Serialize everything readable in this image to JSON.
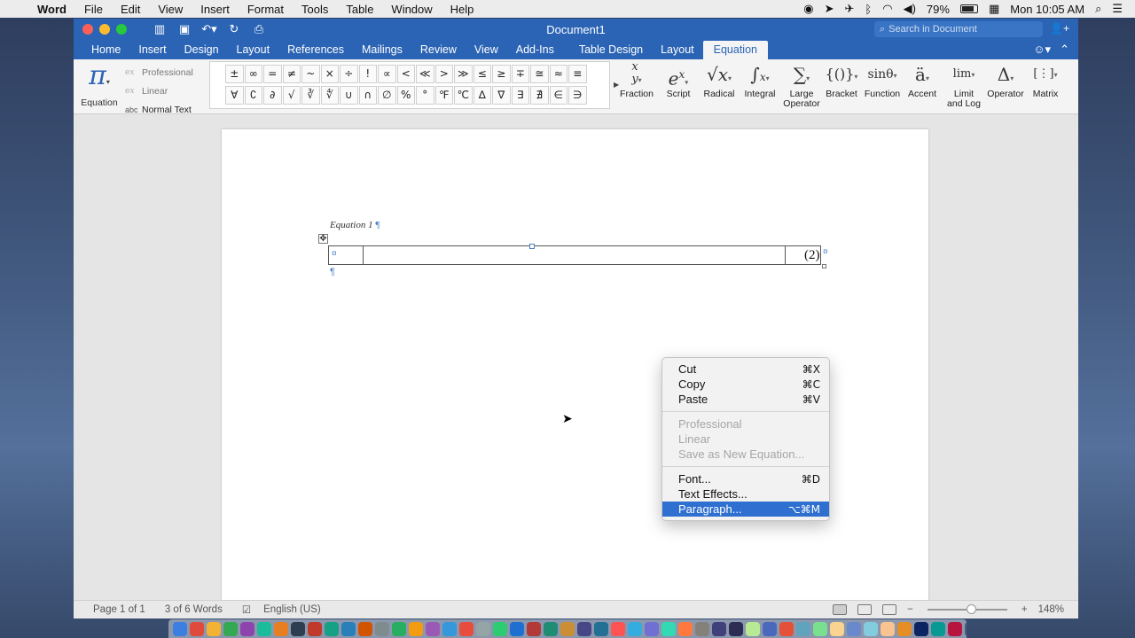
{
  "menubar": {
    "app_name": "Word",
    "items": [
      "File",
      "Edit",
      "View",
      "Insert",
      "Format",
      "Tools",
      "Table",
      "Window",
      "Help"
    ],
    "battery": "79%",
    "clock": "Mon 10:05 AM"
  },
  "window": {
    "title": "Document1",
    "search_placeholder": "Search in Document"
  },
  "tabs": [
    "Home",
    "Insert",
    "Design",
    "Layout",
    "References",
    "Mailings",
    "Review",
    "View",
    "Add-Ins"
  ],
  "context_tabs": [
    "Table Design",
    "Layout"
  ],
  "active_tab": "Equation",
  "ribbon": {
    "equation_label": "Equation",
    "formats": [
      "Professional",
      "Linear",
      "Normal Text"
    ],
    "formats_prefix": "abc",
    "symbols_row1": [
      "±",
      "∞",
      "=",
      "≠",
      "~",
      "×",
      "÷",
      "!",
      "∝",
      "<",
      "≪",
      ">",
      "≫",
      "≤",
      "≥",
      "∓",
      "≅",
      "≈",
      "≡"
    ],
    "symbols_row2": [
      "∀",
      "∁",
      "∂",
      "√",
      "∛",
      "∜",
      "∪",
      "∩",
      "∅",
      "%",
      "°",
      "℉",
      "℃",
      "∆",
      "∇",
      "∃",
      "∄",
      "∈",
      "∋"
    ],
    "structures": [
      {
        "label": "Fraction",
        "label2": ""
      },
      {
        "label": "Script",
        "label2": ""
      },
      {
        "label": "Radical",
        "label2": ""
      },
      {
        "label": "Integral",
        "label2": ""
      },
      {
        "label": "Large",
        "label2": "Operator"
      },
      {
        "label": "Bracket",
        "label2": ""
      },
      {
        "label": "Function",
        "label2": ""
      },
      {
        "label": "Accent",
        "label2": ""
      },
      {
        "label": "Limit",
        "label2": "and Log"
      },
      {
        "label": "Operator",
        "label2": ""
      },
      {
        "label": "Matrix",
        "label2": ""
      }
    ]
  },
  "document": {
    "caption": "Equation 1",
    "equation_number": "(2)"
  },
  "context_menu": {
    "items": [
      {
        "label": "Cut",
        "shortcut": "⌘X",
        "enabled": true
      },
      {
        "label": "Copy",
        "shortcut": "⌘C",
        "enabled": true
      },
      {
        "label": "Paste",
        "shortcut": "⌘V",
        "enabled": true
      },
      {
        "label": "Professional",
        "shortcut": "",
        "enabled": false
      },
      {
        "label": "Linear",
        "shortcut": "",
        "enabled": false
      },
      {
        "label": "Save as New Equation...",
        "shortcut": "",
        "enabled": false
      },
      {
        "label": "Font...",
        "shortcut": "⌘D",
        "enabled": true
      },
      {
        "label": "Text Effects...",
        "shortcut": "",
        "enabled": true
      },
      {
        "label": "Paragraph...",
        "shortcut": "⌥⌘M",
        "enabled": true,
        "highlighted": true
      }
    ]
  },
  "statusbar": {
    "page": "Page 1 of 1",
    "words": "3 of 6 Words",
    "language": "English (US)",
    "zoom": "148%"
  },
  "colors": {
    "ribbon_blue": "#2b64b5",
    "menu_highlight": "#2f6fd0"
  }
}
